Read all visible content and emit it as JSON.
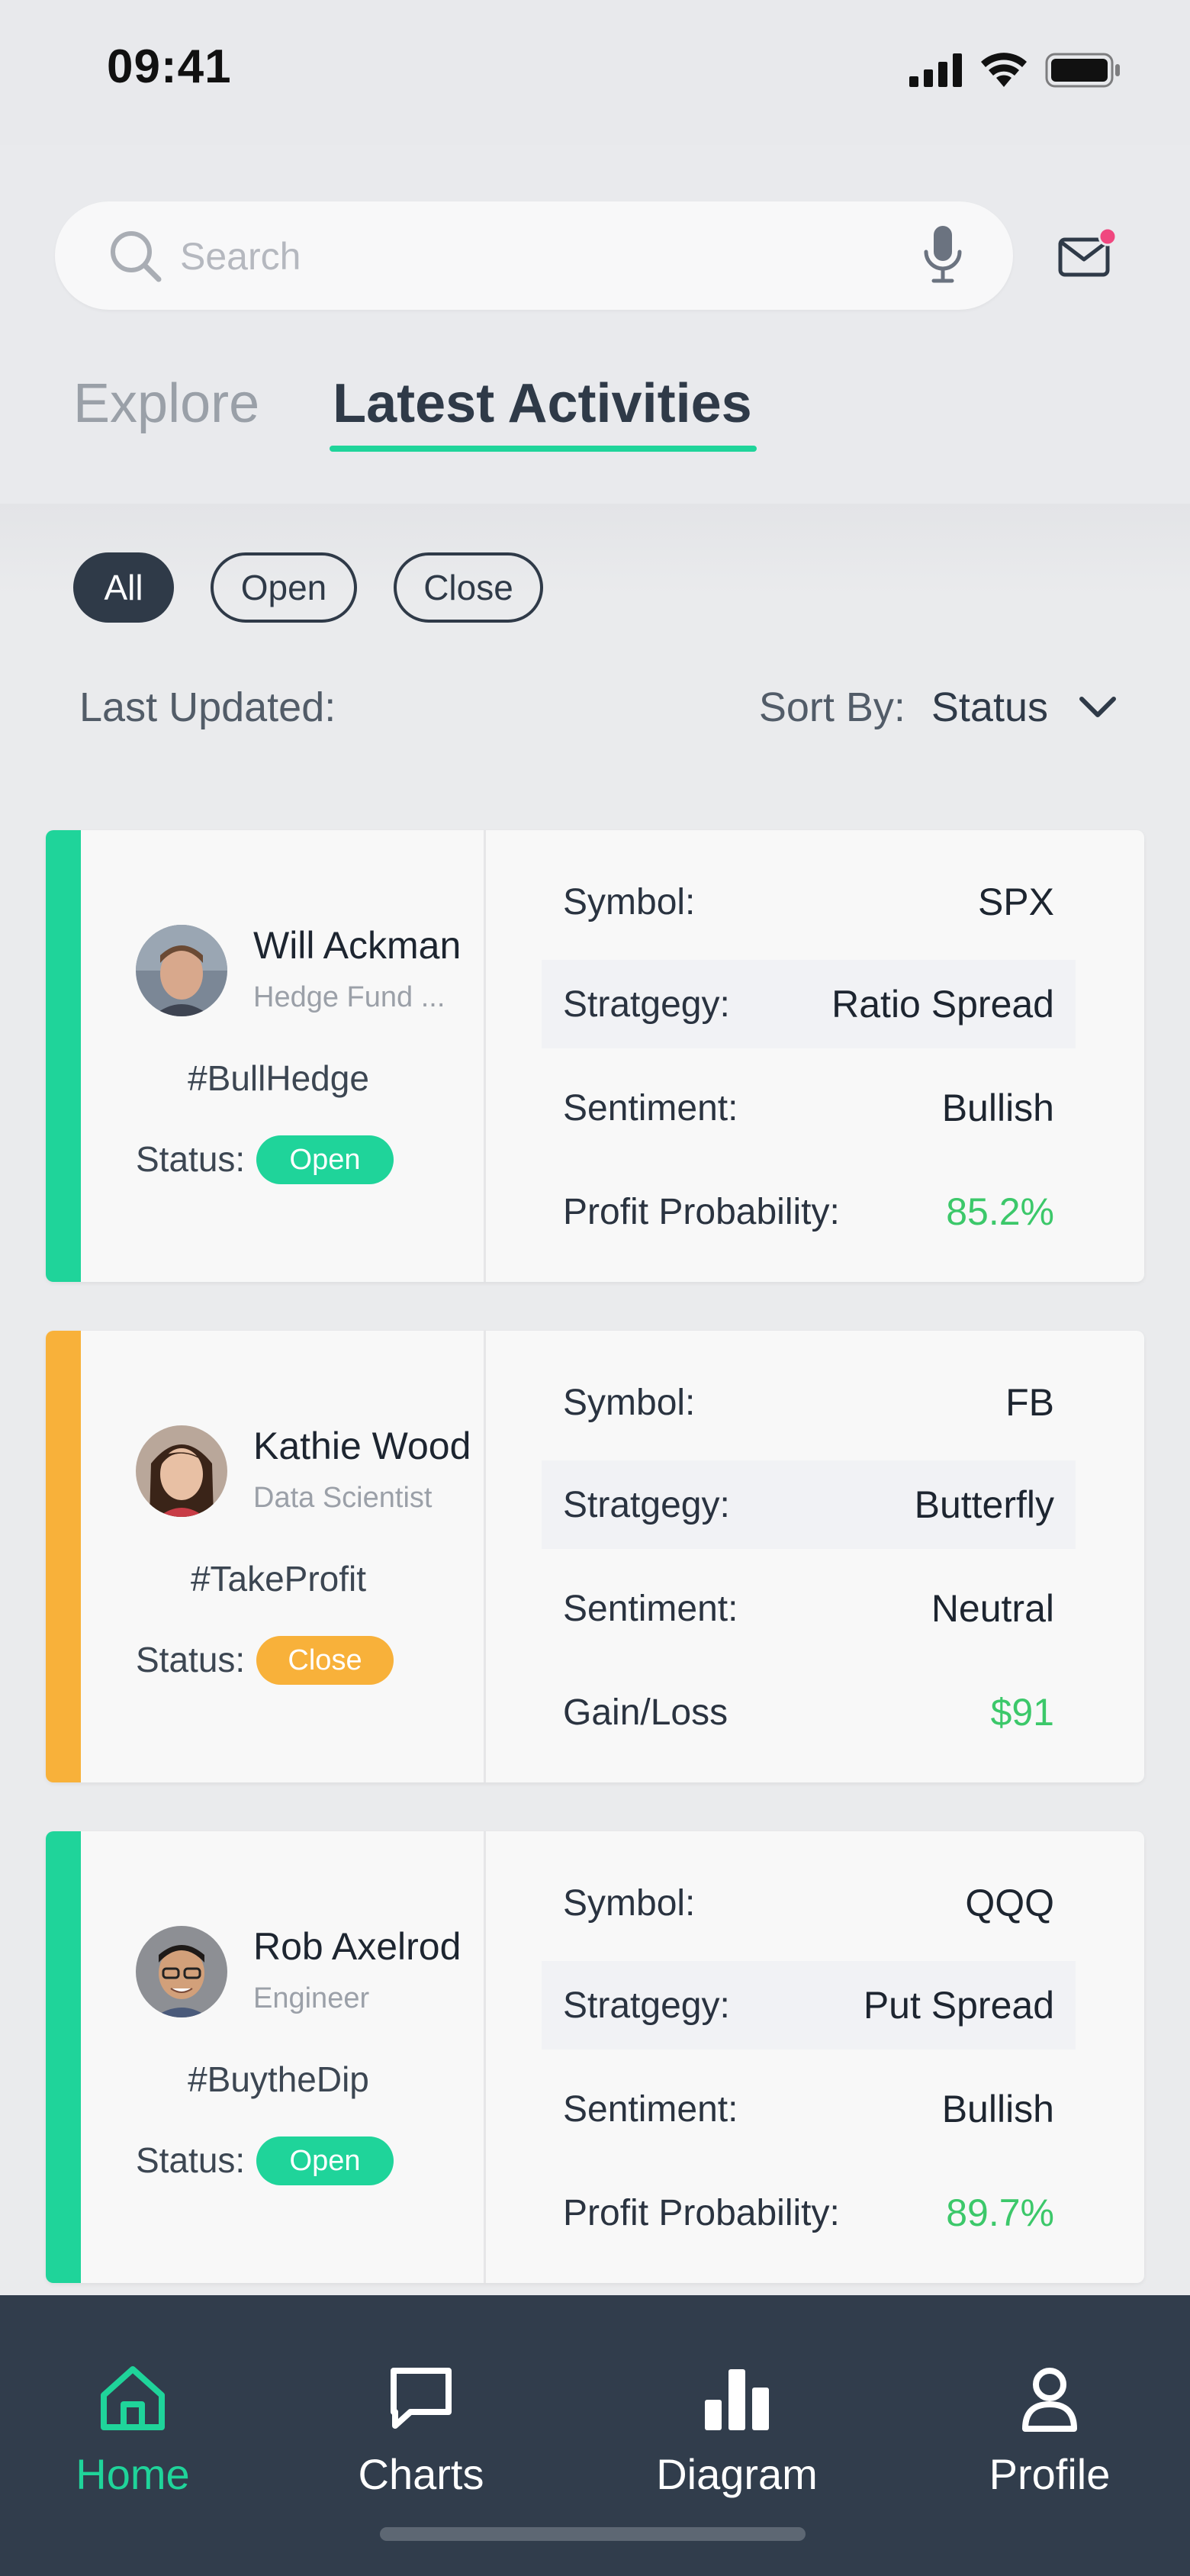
{
  "status_bar": {
    "time": "09:41"
  },
  "search": {
    "placeholder": "Search"
  },
  "tabs": [
    {
      "label": "Explore",
      "active": false
    },
    {
      "label": "Latest Activities",
      "active": true
    }
  ],
  "filters": [
    {
      "label": "All",
      "active": true
    },
    {
      "label": "Open",
      "active": false
    },
    {
      "label": "Close",
      "active": false
    }
  ],
  "meta": {
    "last_updated_label": "Last Updated:",
    "sort_label": "Sort By:",
    "sort_value": "Status"
  },
  "cards": [
    {
      "name": "Will Ackman",
      "role": "Hedge Fund ...",
      "tag": "#BullHedge",
      "status_label": "Status:",
      "status": "Open",
      "accent": "#1fd49a",
      "details": [
        {
          "label": "Symbol:",
          "value": "SPX"
        },
        {
          "label": "Stratgegy:",
          "value": "Ratio Spread"
        },
        {
          "label": "Sentiment:",
          "value": "Bullish"
        },
        {
          "label": "Profit Probability:",
          "value": "85.2%"
        }
      ]
    },
    {
      "name": "Kathie Wood",
      "role": "Data Scientist",
      "tag": "#TakeProfit",
      "status_label": "Status:",
      "status": "Close",
      "accent": "#f8b13a",
      "details": [
        {
          "label": "Symbol:",
          "value": "FB"
        },
        {
          "label": "Stratgegy:",
          "value": "Butterfly"
        },
        {
          "label": "Sentiment:",
          "value": "Neutral"
        },
        {
          "label": "Gain/Loss",
          "value": "$91"
        }
      ]
    },
    {
      "name": "Rob Axelrod",
      "role": "Engineer",
      "tag": "#BuytheDip",
      "status_label": "Status:",
      "status": "Open",
      "accent": "#1fd49a",
      "details": [
        {
          "label": "Symbol:",
          "value": "QQQ"
        },
        {
          "label": "Stratgegy:",
          "value": "Put Spread"
        },
        {
          "label": "Sentiment:",
          "value": "Bullish"
        },
        {
          "label": "Profit Probability:",
          "value": "89.7%"
        }
      ]
    }
  ],
  "nav": [
    {
      "label": "Home",
      "icon": "home-icon",
      "active": true
    },
    {
      "label": "Charts",
      "icon": "chat-icon",
      "active": false
    },
    {
      "label": "Diagram",
      "icon": "bar-chart-icon",
      "active": false
    },
    {
      "label": "Profile",
      "icon": "user-icon",
      "active": false
    }
  ],
  "colors": {
    "accent": "#1fd49a",
    "warning": "#f8b13a",
    "dark": "#313d4c",
    "positive": "#3cc86a",
    "notification": "#f0477f"
  }
}
